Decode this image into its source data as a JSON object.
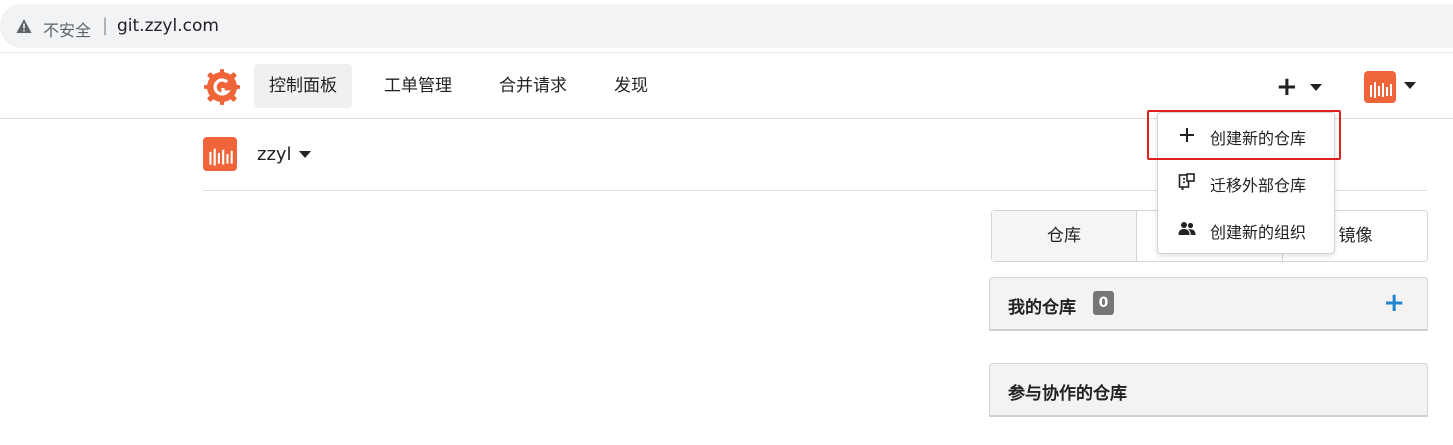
{
  "browser": {
    "security_label": "不安全",
    "separator": "|",
    "url": "git.zzyl.com"
  },
  "nav": {
    "items": [
      {
        "label": "控制面板",
        "active": true
      },
      {
        "label": "工单管理"
      },
      {
        "label": "合并请求"
      },
      {
        "label": "发现"
      }
    ],
    "create_icon": "plus-icon",
    "avatar_icon": "user-avatar"
  },
  "context": {
    "user": "zzyl"
  },
  "create_menu": {
    "items": [
      {
        "label": "创建新的仓库",
        "icon": "plus-icon"
      },
      {
        "label": "迁移外部仓库",
        "icon": "migrate-icon"
      },
      {
        "label": "创建新的组织",
        "icon": "organization-icon"
      }
    ]
  },
  "repo_tabs": {
    "items": [
      {
        "label": "仓库"
      },
      {
        "label": ""
      },
      {
        "label": "镜像"
      }
    ]
  },
  "my_repos": {
    "title": "我的仓库",
    "count": "0",
    "add": "+"
  },
  "collab_repos": {
    "title": "参与协作的仓库"
  },
  "colors": {
    "brand_orange": "#f0643a",
    "accent_blue": "#2185d0",
    "highlight_red": "#e02020"
  }
}
